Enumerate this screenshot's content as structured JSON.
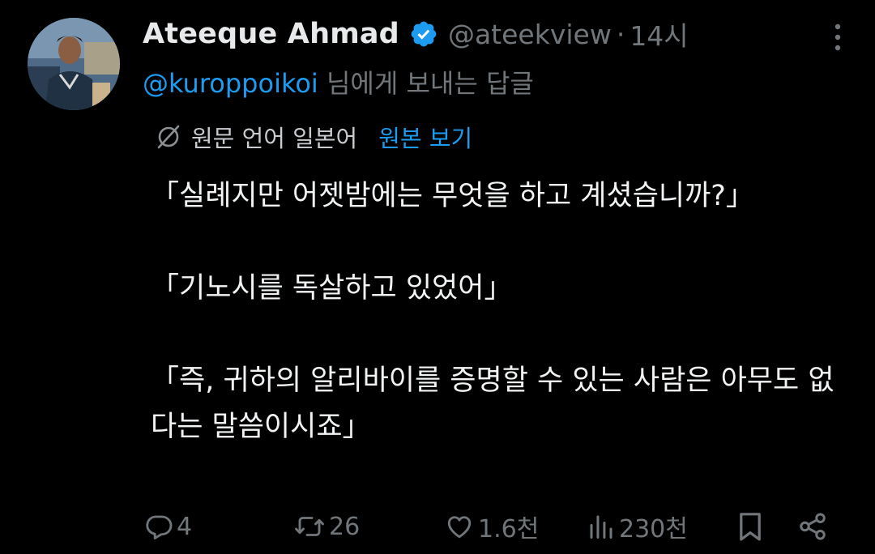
{
  "author": {
    "display_name": "Ateeque Ahmad",
    "handle": "@ateekview",
    "separator": "·",
    "time": "14시"
  },
  "reply": {
    "handle": "@kuroppoikoi",
    "suffix": " 님에게 보내는 답글"
  },
  "translation": {
    "label": "원문 언어 일본어",
    "show_original": "원본 보기"
  },
  "body": "「실례지만 어젯밤에는 무엇을 하고 계셨습니까?」\n\n「기노시를 독살하고 있었어」\n\n「즉, 귀하의 알리바이를 증명할 수 있는 사람은 아무도 없다는 말씀이시죠」",
  "stats": {
    "replies": "4",
    "reposts": "26",
    "likes": "1.6천",
    "views": "230천"
  },
  "icons": {
    "verified": "verified-badge-icon",
    "more": "more-options-icon",
    "translate": "translate-globe-icon",
    "reply": "reply-icon",
    "repost": "repost-icon",
    "like": "like-icon",
    "views": "views-icon",
    "bookmark": "bookmark-icon",
    "share": "share-icon"
  },
  "colors": {
    "background": "#000000",
    "text": "#e7e9ea",
    "secondary": "#71767b",
    "accent": "#1d9bf0"
  }
}
